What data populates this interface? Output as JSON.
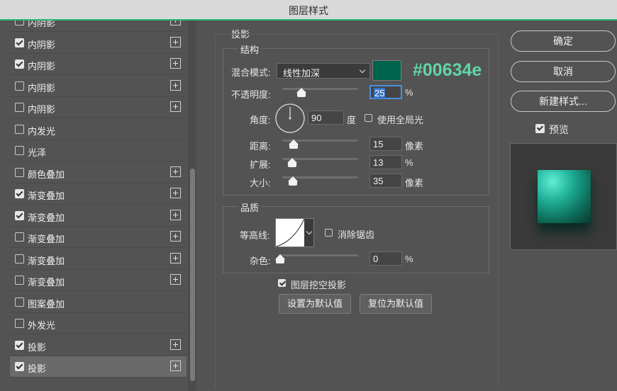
{
  "window": {
    "title": "图层样式"
  },
  "layer_list": [
    {
      "label": "内阴影",
      "checked": false,
      "has_plus": true,
      "selected": false
    },
    {
      "label": "内阴影",
      "checked": true,
      "has_plus": true,
      "selected": false
    },
    {
      "label": "内阴影",
      "checked": true,
      "has_plus": true,
      "selected": false
    },
    {
      "label": "内阴影",
      "checked": false,
      "has_plus": true,
      "selected": false
    },
    {
      "label": "内阴影",
      "checked": false,
      "has_plus": true,
      "selected": false
    },
    {
      "label": "内发光",
      "checked": false,
      "has_plus": false,
      "selected": false
    },
    {
      "label": "光泽",
      "checked": false,
      "has_plus": false,
      "selected": false
    },
    {
      "label": "颜色叠加",
      "checked": false,
      "has_plus": true,
      "selected": false
    },
    {
      "label": "渐变叠加",
      "checked": true,
      "has_plus": true,
      "selected": false
    },
    {
      "label": "渐变叠加",
      "checked": true,
      "has_plus": true,
      "selected": false
    },
    {
      "label": "渐变叠加",
      "checked": false,
      "has_plus": true,
      "selected": false
    },
    {
      "label": "渐变叠加",
      "checked": false,
      "has_plus": true,
      "selected": false
    },
    {
      "label": "渐变叠加",
      "checked": false,
      "has_plus": true,
      "selected": false
    },
    {
      "label": "图案叠加",
      "checked": false,
      "has_plus": false,
      "selected": false
    },
    {
      "label": "外发光",
      "checked": false,
      "has_plus": false,
      "selected": false
    },
    {
      "label": "投影",
      "checked": true,
      "has_plus": true,
      "selected": false
    },
    {
      "label": "投影",
      "checked": true,
      "has_plus": true,
      "selected": true
    }
  ],
  "shadow": {
    "section_title": "投影",
    "structure_title": "结构",
    "blend_label": "混合模式:",
    "blend_value": "线性加深",
    "color_hex": "#00634e",
    "color_annotation": "#00634e",
    "opacity_label": "不透明度:",
    "opacity_value": "25",
    "opacity_unit": "%",
    "opacity_level": 0.25,
    "angle_label": "角度:",
    "angle_value": "90",
    "angle_unit": "度",
    "global_light_label": "使用全局光",
    "global_light_checked": false,
    "distance_label": "距离:",
    "distance_value": "15",
    "distance_unit": "像素",
    "distance_level": 0.15,
    "spread_label": "扩展:",
    "spread_value": "13",
    "spread_unit": "%",
    "spread_level": 0.13,
    "size_label": "大小:",
    "size_value": "35",
    "size_unit": "像素",
    "size_level": 0.14,
    "quality_title": "品质",
    "contour_label": "等高线:",
    "antialias_label": "消除锯齿",
    "antialias_checked": false,
    "noise_label": "杂色:",
    "noise_value": "0",
    "noise_unit": "%",
    "noise_level": 0,
    "knockout_label": "图层挖空投影",
    "knockout_checked": true,
    "set_default_label": "设置为默认值",
    "reset_default_label": "复位为默认值"
  },
  "actions": {
    "ok_label": "确定",
    "cancel_label": "取消",
    "new_style_label": "新建样式...",
    "preview_label": "预览",
    "preview_checked": true
  },
  "colors": {
    "accent": "#2fb37a",
    "annotation": "#5fd6a8",
    "preview_top": "#5ff0d6",
    "preview_bottom": "#0a3a30"
  }
}
